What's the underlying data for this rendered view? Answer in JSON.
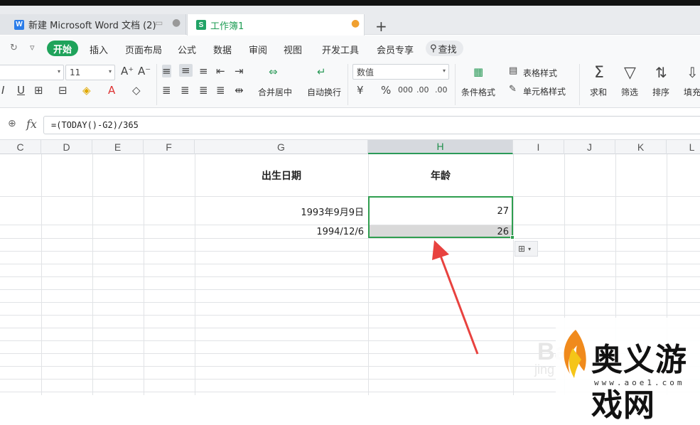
{
  "tabs": [
    {
      "label": "新建 Microsoft Word 文档 (2)",
      "icon": "W"
    },
    {
      "label": "工作簿1",
      "icon": "S"
    }
  ],
  "new_tab_label": "+",
  "menu": {
    "items": [
      "开始",
      "插入",
      "页面布局",
      "公式",
      "数据",
      "审阅",
      "视图",
      "开发工具",
      "会员专享"
    ],
    "search": "查找"
  },
  "ribbon": {
    "font_size": "11",
    "number_format": "数值",
    "merge_center": "合并居中",
    "wrap_text": "自动换行",
    "conditional_format": "条件格式",
    "table_style": "表格样式",
    "cell_style": "单元格样式",
    "sum": "求和",
    "filter": "筛选",
    "sort": "排序",
    "fill": "填充",
    "currency": "¥",
    "percent": "%",
    "thousands": "000",
    "inc_decimal": ".00",
    "dec_decimal": ".00"
  },
  "formula": {
    "fx": "fx",
    "text": "=(TODAY()-G2)/365"
  },
  "columns": [
    "C",
    "D",
    "E",
    "F",
    "G",
    "H",
    "I",
    "J",
    "K",
    "L"
  ],
  "active_column": "H",
  "headers": {
    "g": "出生日期",
    "h": "年龄"
  },
  "rows": [
    {
      "birth": "1993年9月9日",
      "age": "27"
    },
    {
      "birth": "1994/12/6",
      "age": "26"
    }
  ],
  "watermark": {
    "brand": "奥义游戏网",
    "url": "www.aoe1.com",
    "faint": "Bai",
    "faint2": "jing"
  },
  "colors": {
    "accent": "#1fa35b",
    "selection": "#2f9e4f",
    "arrow": "#e8423f"
  }
}
